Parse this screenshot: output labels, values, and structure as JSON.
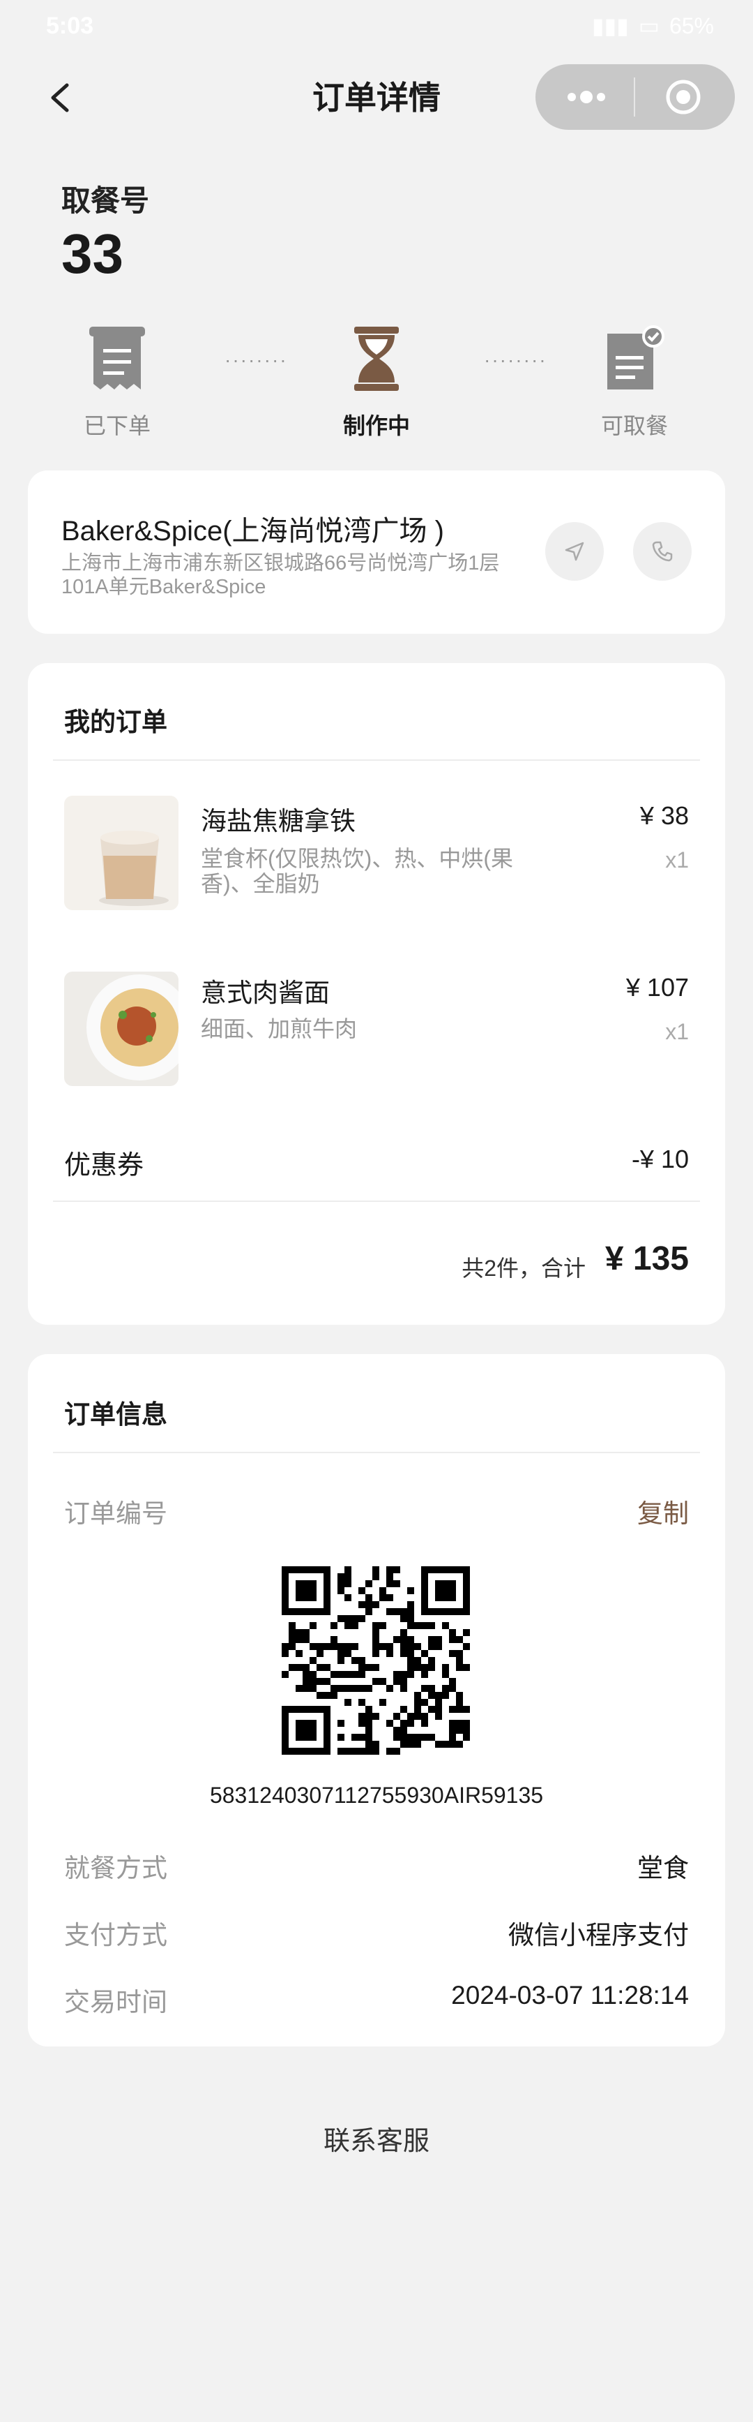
{
  "status_bar": {
    "time": "5:03",
    "battery": "65%"
  },
  "header": {
    "title": "订单详情"
  },
  "pickup": {
    "label": "取餐号",
    "number": "33"
  },
  "steps": [
    {
      "label": "已下单"
    },
    {
      "label": "制作中"
    },
    {
      "label": "可取餐"
    }
  ],
  "step_dots": "········",
  "store": {
    "name": "Baker&Spice(上海尚悦湾广场 )",
    "address": "上海市上海市浦东新区银城路66号尚悦湾广场1层101A单元Baker&Spice"
  },
  "order": {
    "title": "我的订单",
    "items": [
      {
        "name": "海盐焦糖拿铁",
        "spec": "堂食杯(仅限热饮)、热、中烘(果香)、全脂奶",
        "price": "¥ 38",
        "qty": "x1"
      },
      {
        "name": "意式肉酱面",
        "spec": "细面、加煎牛肉",
        "price": "¥ 107",
        "qty": "x1"
      }
    ],
    "coupon_label": "优惠券",
    "coupon_value": "-¥ 10",
    "summary_prefix": "共2件，合计",
    "total": "¥ 135"
  },
  "info": {
    "title": "订单信息",
    "order_no_label": "订单编号",
    "copy_label": "复制",
    "order_no": "5831240307112755930AIR59135",
    "rows": [
      {
        "label": "就餐方式",
        "value": "堂食"
      },
      {
        "label": "支付方式",
        "value": "微信小程序支付"
      },
      {
        "label": "交易时间",
        "value": "2024-03-07 11:28:14"
      }
    ]
  },
  "service": {
    "label": "联系客服"
  },
  "colors": {
    "accent": "#7a5a44",
    "background": "#f2f2f2",
    "capsule": "#c8c8c8"
  }
}
